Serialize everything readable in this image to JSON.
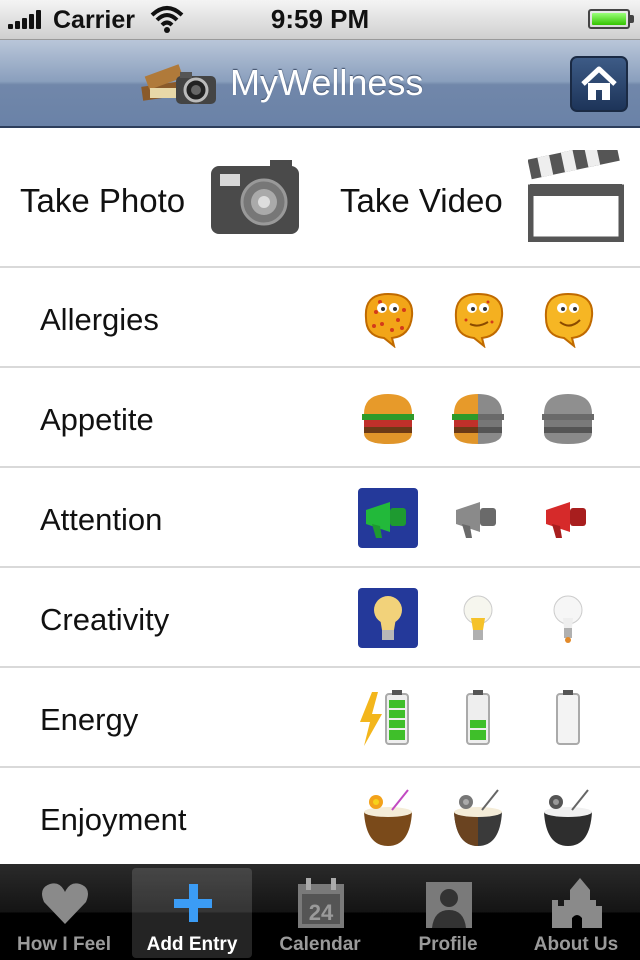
{
  "status_bar": {
    "carrier": "Carrier",
    "time": "9:59 PM"
  },
  "nav_bar": {
    "title": "MyWellness"
  },
  "media": {
    "photo_label": "Take Photo",
    "video_label": "Take Video"
  },
  "rows": [
    {
      "label": "Allergies"
    },
    {
      "label": "Appetite"
    },
    {
      "label": "Attention"
    },
    {
      "label": "Creativity"
    },
    {
      "label": "Energy"
    },
    {
      "label": "Enjoyment"
    }
  ],
  "tab_bar": {
    "tabs": [
      {
        "label": "How I Feel",
        "icon": "heart-icon"
      },
      {
        "label": "Add Entry",
        "icon": "plus-icon"
      },
      {
        "label": "Calendar",
        "icon": "calendar-icon",
        "day": "24"
      },
      {
        "label": "Profile",
        "icon": "profile-icon"
      },
      {
        "label": "About Us",
        "icon": "castle-icon"
      }
    ],
    "selected_index": 1
  },
  "colors": {
    "nav_accent": "#6a82a7",
    "tab_selected_icon": "#3b9cf5",
    "battery": "#34c400"
  }
}
